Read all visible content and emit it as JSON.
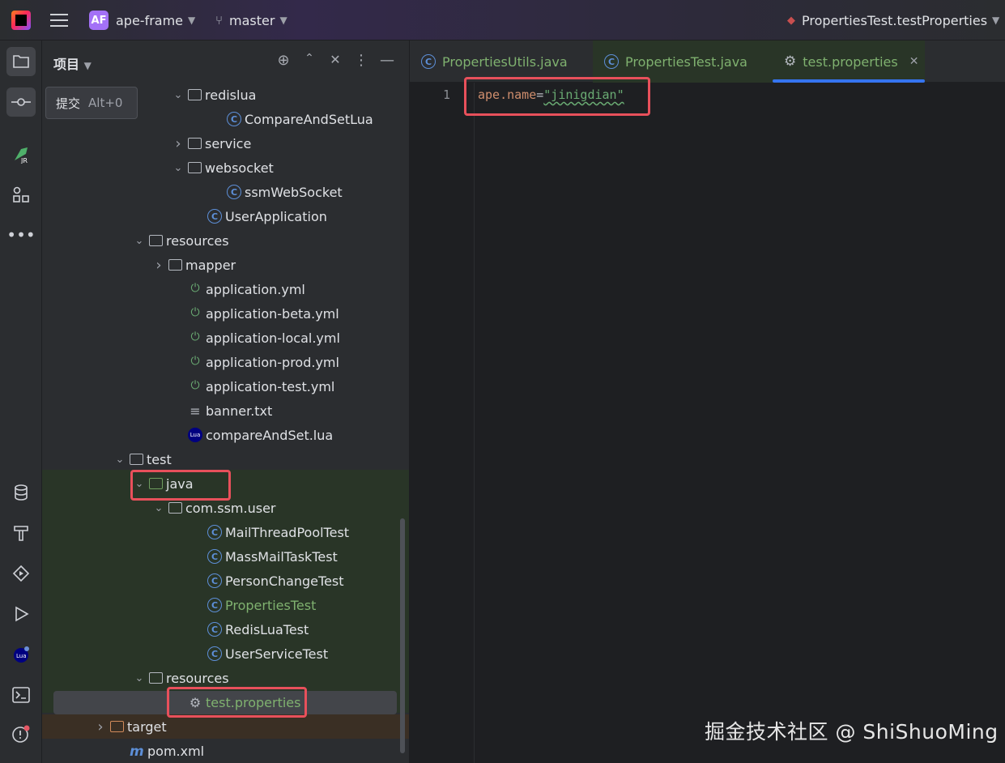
{
  "titlebar": {
    "project_badge": "AF",
    "project_name": "ape-frame",
    "branch": "master",
    "run_config": "PropertiesTest.testProperties"
  },
  "panel": {
    "title": "项目",
    "tooltip": {
      "label": "提交",
      "shortcut": "Alt+0"
    }
  },
  "tree": [
    {
      "label": "redislua",
      "type": "package",
      "arrow": "expanded"
    },
    {
      "label": "CompareAndSetLua",
      "type": "class"
    },
    {
      "label": "service",
      "type": "package",
      "arrow": "collapsed"
    },
    {
      "label": "websocket",
      "type": "package",
      "arrow": "expanded"
    },
    {
      "label": "ssmWebSocket",
      "type": "class"
    },
    {
      "label": "UserApplication",
      "type": "spring-class"
    },
    {
      "label": "resources",
      "type": "resources",
      "arrow": "expanded"
    },
    {
      "label": "mapper",
      "type": "folder",
      "arrow": "collapsed"
    },
    {
      "label": "application.yml",
      "type": "yml"
    },
    {
      "label": "application-beta.yml",
      "type": "yml"
    },
    {
      "label": "application-local.yml",
      "type": "yml"
    },
    {
      "label": "application-prod.yml",
      "type": "yml"
    },
    {
      "label": "application-test.yml",
      "type": "yml"
    },
    {
      "label": "banner.txt",
      "type": "txt"
    },
    {
      "label": "compareAndSet.lua",
      "type": "lua"
    },
    {
      "label": "test",
      "type": "folder",
      "arrow": "expanded"
    },
    {
      "label": "java",
      "type": "test-folder",
      "arrow": "expanded"
    },
    {
      "label": "com.ssm.user",
      "type": "package",
      "arrow": "expanded"
    },
    {
      "label": "MailThreadPoolTest",
      "type": "class"
    },
    {
      "label": "MassMailTaskTest",
      "type": "class"
    },
    {
      "label": "PersonChangeTest",
      "type": "class"
    },
    {
      "label": "PropertiesTest",
      "type": "class"
    },
    {
      "label": "RedisLuaTest",
      "type": "class"
    },
    {
      "label": "UserServiceTest",
      "type": "class"
    },
    {
      "label": "resources",
      "type": "test-resources",
      "arrow": "expanded"
    },
    {
      "label": "test.properties",
      "type": "properties"
    },
    {
      "label": "target",
      "type": "target-folder",
      "arrow": "collapsed"
    },
    {
      "label": "pom.xml",
      "type": "maven"
    }
  ],
  "tabs": [
    {
      "label": "PropertiesUtils.java",
      "icon": "class-icon"
    },
    {
      "label": "PropertiesTest.java",
      "icon": "class-icon"
    },
    {
      "label": "test.properties",
      "icon": "gear-icon"
    }
  ],
  "editor": {
    "line_number": "1",
    "code_key": "ape.name",
    "code_eq": "=",
    "code_value": "\"jinigdian\""
  },
  "watermark": "掘金技术社区 @ ShiShuoMing",
  "colors": {
    "accent": "#3574f0",
    "highlight_box": "#e8505b",
    "modified_green": "#7fb16f",
    "badge_purple": "#a371f7"
  }
}
